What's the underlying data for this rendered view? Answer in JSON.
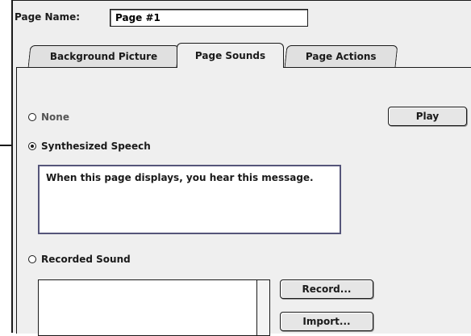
{
  "page_name": {
    "label": "Page Name:",
    "value": "Page #1"
  },
  "tabs": [
    {
      "label": "Background Picture",
      "selected": false
    },
    {
      "label": "Page Sounds",
      "selected": true
    },
    {
      "label": "Page Actions",
      "selected": false
    }
  ],
  "sound_options": [
    {
      "label": "None",
      "selected": false
    },
    {
      "label": "Synthesized Speech",
      "selected": true
    },
    {
      "label": "Recorded Sound",
      "selected": false
    }
  ],
  "speech_text": "When this page displays, you hear this message.",
  "buttons": {
    "play": "Play",
    "record": "Record...",
    "import": "Import..."
  },
  "recorded_sounds": []
}
